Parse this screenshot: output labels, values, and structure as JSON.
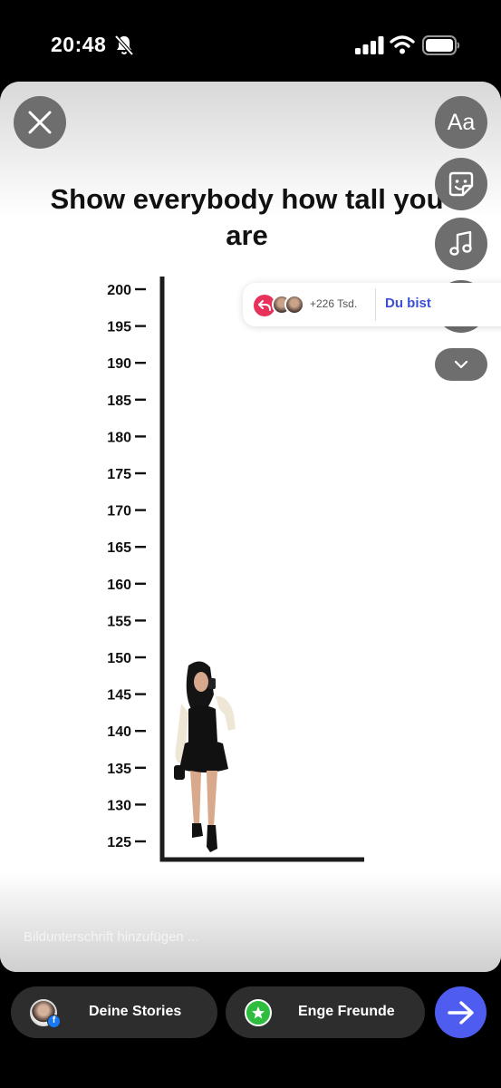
{
  "status_bar": {
    "time": "20:48"
  },
  "story": {
    "title": "Show everybody how tall you are",
    "caption_placeholder": "Bildunterschrift hinzufügen ..."
  },
  "tools": {
    "text_label": "Aa",
    "mention_label": "@"
  },
  "add_yours": {
    "participants": "+226 Tsd.",
    "cta": "Du bist"
  },
  "chart_data": {
    "type": "other",
    "title": "Show everybody how tall you are",
    "y_ticks": [
      200,
      195,
      190,
      185,
      180,
      175,
      170,
      165,
      160,
      155,
      150,
      145,
      140,
      135,
      130,
      125
    ],
    "ylim": [
      125,
      200
    ]
  },
  "share": {
    "stories_label": "Deine Stories",
    "friends_label": "Enge Freunde"
  }
}
